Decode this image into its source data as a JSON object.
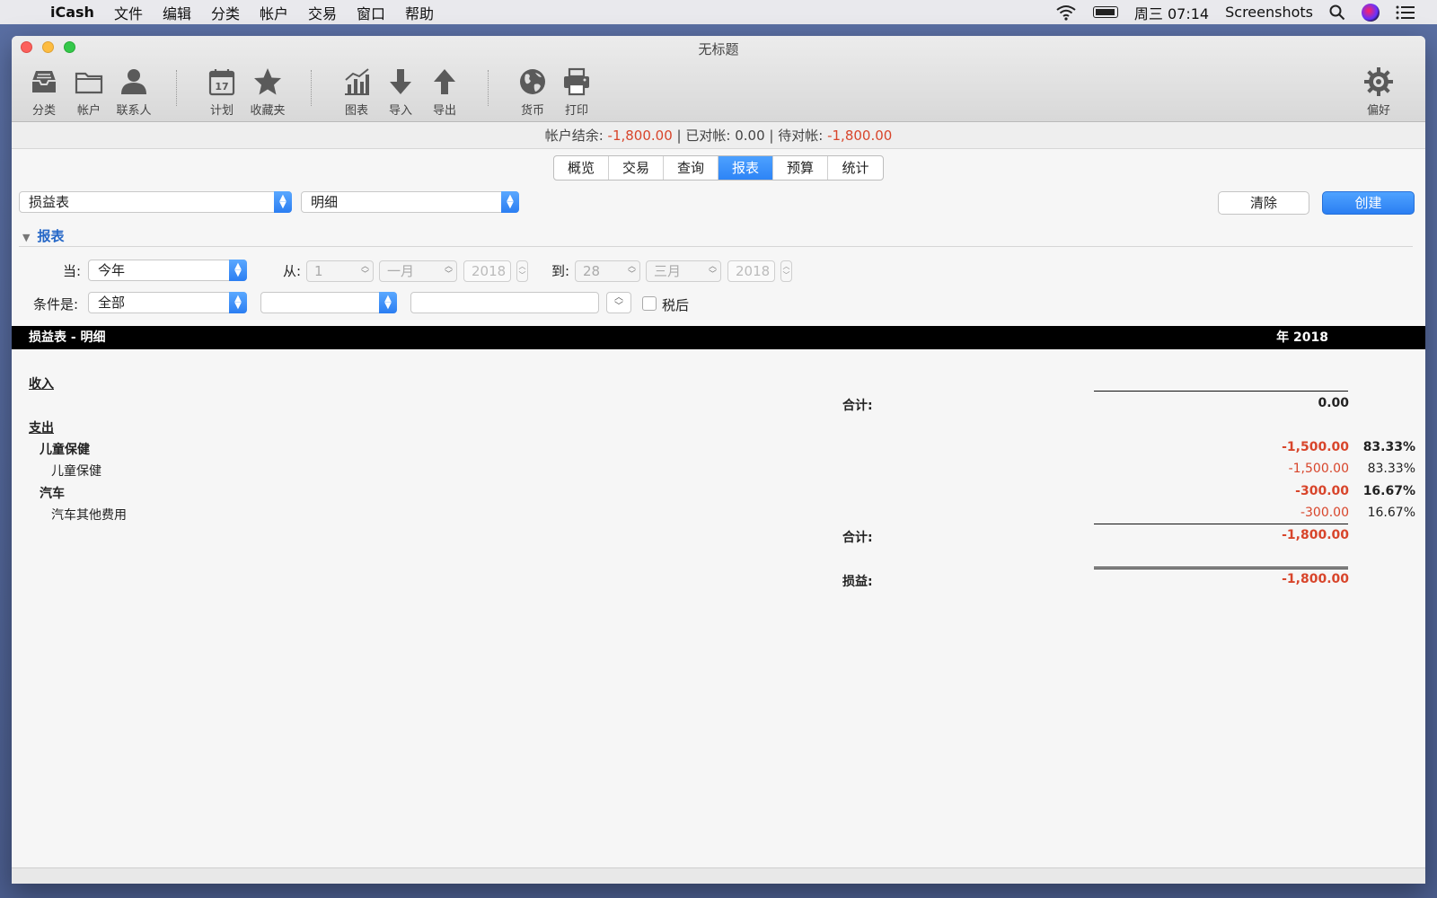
{
  "menubar": {
    "app": "iCash",
    "items": [
      "文件",
      "编辑",
      "分类",
      "帐户",
      "交易",
      "窗口",
      "帮助"
    ],
    "clock": "周三 07:14",
    "screenshots": "Screenshots"
  },
  "window": {
    "title": "无标题"
  },
  "toolbar": {
    "categories": "分类",
    "accounts": "帐户",
    "contacts": "联系人",
    "schedule": "计划",
    "favorites": "收藏夹",
    "charts": "图表",
    "import": "导入",
    "export": "导出",
    "currency": "货币",
    "print": "打印",
    "preferences": "偏好",
    "calendar_day": "17"
  },
  "balance": {
    "label_account": "帐户结余:",
    "account_value": "-1,800.00",
    "sep1": "|",
    "label_reconciled": "已对帐:",
    "reconciled_value": "0.00",
    "sep2": "|",
    "label_pending": "待对帐:",
    "pending_value": "-1,800.00"
  },
  "tabs": [
    "概览",
    "交易",
    "查询",
    "报表",
    "预算",
    "统计"
  ],
  "active_tab": "报表",
  "report_controls": {
    "report_type": "损益表",
    "detail_level": "明细",
    "clear_button": "清除",
    "create_button": "创建",
    "section_label": "报表",
    "when_label": "当:",
    "when_value": "今年",
    "from_label": "从:",
    "from_day": "1",
    "from_month": "一月",
    "from_year": "2018",
    "to_label": "到:",
    "to_day": "28",
    "to_month": "三月",
    "to_year": "2018",
    "condition_label": "条件是:",
    "condition_value": "全部",
    "condition_field2": "",
    "condition_field3": "",
    "after_tax_label": "税后"
  },
  "report": {
    "header_title": "损益表 - 明细",
    "header_period": "年 2018",
    "income_label": "收入",
    "income_total_label": "合计:",
    "income_total": "0.00",
    "expense_label": "支出",
    "rows": [
      {
        "name": "儿童保健",
        "amount": "-1,500.00",
        "pct": "83.33%",
        "level": 1
      },
      {
        "name": "儿童保健",
        "amount": "-1,500.00",
        "pct": "83.33%",
        "level": 2
      },
      {
        "name": "汽车",
        "amount": "-300.00",
        "pct": "16.67%",
        "level": 1
      },
      {
        "name": "汽车其他费用",
        "amount": "-300.00",
        "pct": "16.67%",
        "level": 2
      }
    ],
    "expense_total_label": "合计:",
    "expense_total": "-1,800.00",
    "profit_label": "损益:",
    "profit_value": "-1,800.00"
  }
}
